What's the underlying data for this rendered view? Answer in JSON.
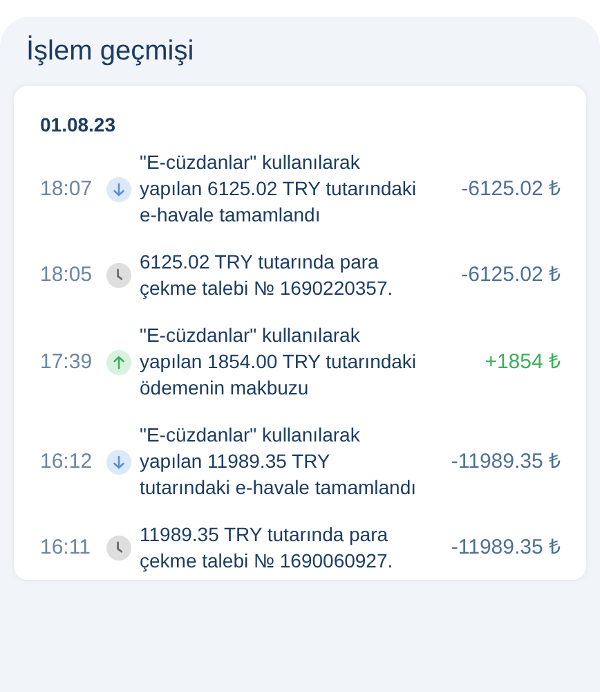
{
  "title": "İşlem geçmişi",
  "groups": [
    {
      "date": "01.08.23",
      "transactions": [
        {
          "time": "18:07",
          "kind": "outgoing",
          "description": "\"E-cüzdanlar\" kullanılarak yapılan 6125.02 TRY tutarındaki e-havale tamamlandı",
          "amount": "-6125.02 ₺"
        },
        {
          "time": "18:05",
          "kind": "pending",
          "description": "6125.02 TRY tutarında para çekme talebi № 1690220357.",
          "amount": "-6125.02 ₺"
        },
        {
          "time": "17:39",
          "kind": "incoming",
          "description": "\"E-cüzdanlar\" kullanılarak yapılan 1854.00 TRY tutarındaki ödemenin makbuzu",
          "amount": "+1854 ₺"
        },
        {
          "time": "16:12",
          "kind": "outgoing",
          "description": "\"E-cüzdanlar\" kullanılarak yapılan 11989.35 TRY tutarındaki e-havale tamamlandı",
          "amount": "-11989.35 ₺"
        },
        {
          "time": "16:11",
          "kind": "pending",
          "description": "11989.35 TRY tutarında para çekme talebi № 1690060927.",
          "amount": "-11989.35 ₺"
        }
      ]
    }
  ]
}
